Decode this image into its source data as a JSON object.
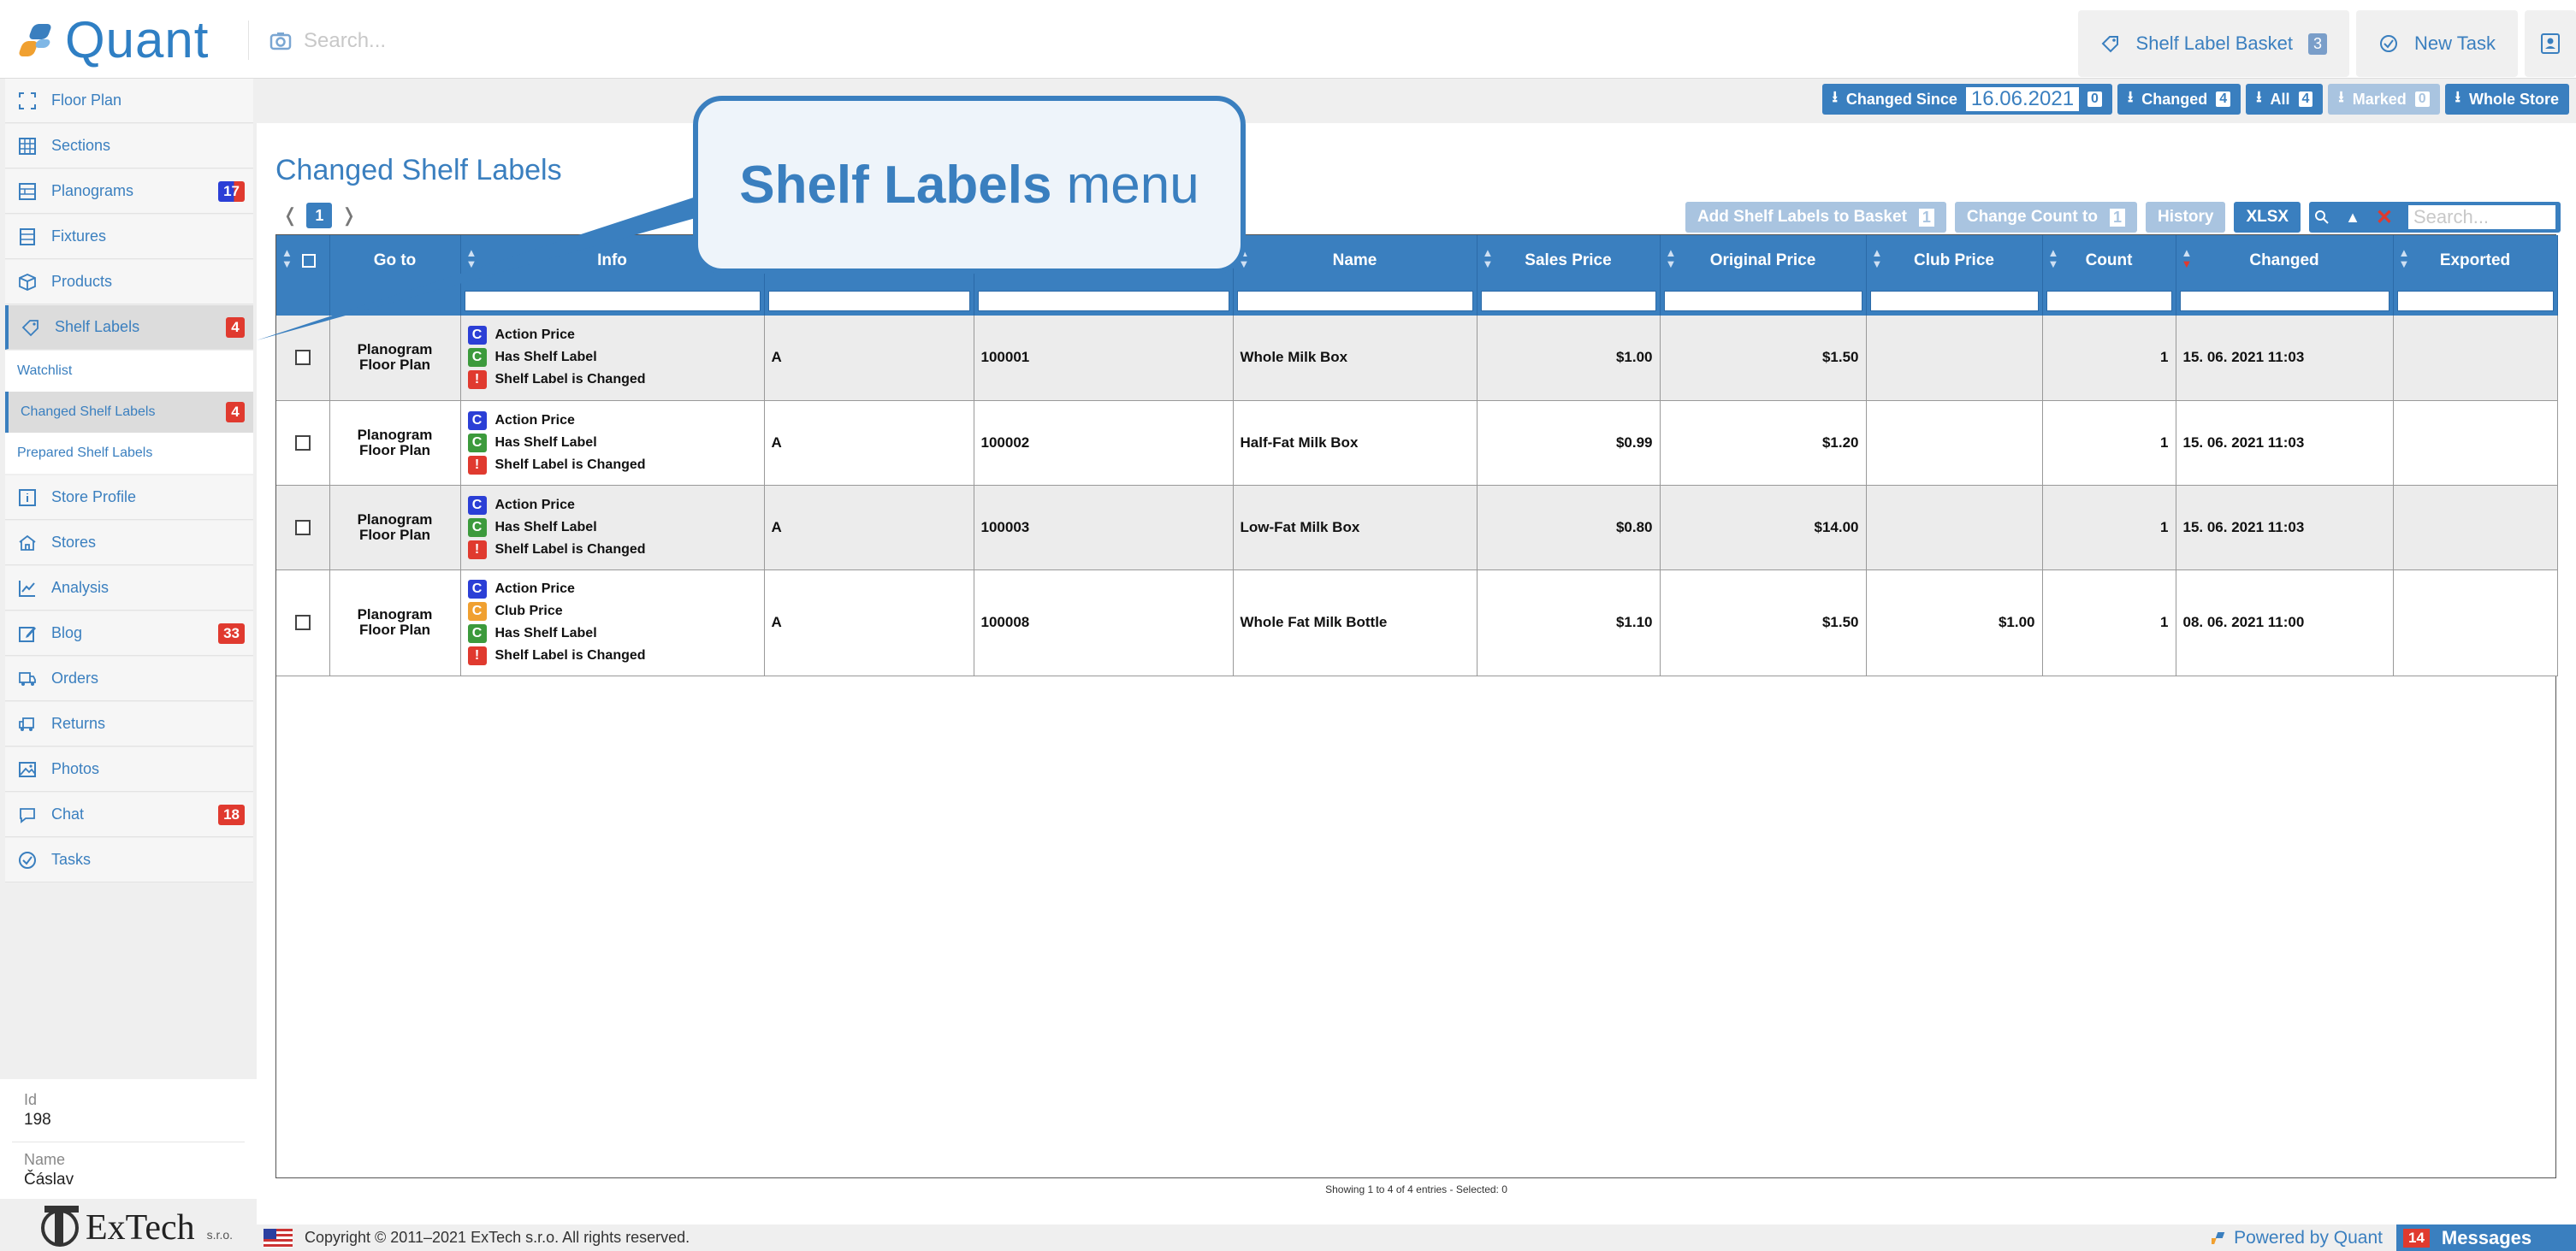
{
  "app": {
    "name": "Quant"
  },
  "topbar": {
    "search_placeholder": "Search...",
    "basket_label": "Shelf Label Basket",
    "basket_count": "3",
    "new_task_label": "New Task"
  },
  "sidebar": {
    "items": [
      {
        "label": "Floor Plan",
        "icon": "floor-plan-icon"
      },
      {
        "label": "Sections",
        "icon": "grid-icon"
      },
      {
        "label": "Planograms",
        "icon": "planogram-icon",
        "badge": "17"
      },
      {
        "label": "Fixtures",
        "icon": "fixture-icon"
      },
      {
        "label": "Products",
        "icon": "box-icon"
      },
      {
        "label": "Shelf Labels",
        "icon": "tag-icon",
        "badge": "4"
      },
      {
        "label": "Store Profile",
        "icon": "info-icon"
      },
      {
        "label": "Stores",
        "icon": "store-icon"
      },
      {
        "label": "Analysis",
        "icon": "chart-icon"
      },
      {
        "label": "Blog",
        "icon": "blog-icon",
        "badge": "33"
      },
      {
        "label": "Orders",
        "icon": "truck-icon"
      },
      {
        "label": "Returns",
        "icon": "return-icon"
      },
      {
        "label": "Photos",
        "icon": "photo-icon"
      },
      {
        "label": "Chat",
        "icon": "chat-icon",
        "badge": "18"
      },
      {
        "label": "Tasks",
        "icon": "check-circle-icon"
      }
    ],
    "sub_items": [
      {
        "label": "Watchlist"
      },
      {
        "label": "Changed Shelf Labels",
        "badge": "4"
      },
      {
        "label": "Prepared Shelf Labels"
      }
    ],
    "store": {
      "id_label": "Id",
      "id_value": "198",
      "name_label": "Name",
      "name_value": "Čáslav"
    },
    "company": {
      "name": "ExTech",
      "suffix": "s.r.o."
    }
  },
  "actions": {
    "changed_since_label": "Changed Since",
    "changed_since_date": "16.06.2021",
    "changed_since_count": "0",
    "changed_label": "Changed",
    "changed_count": "4",
    "all_label": "All",
    "all_count": "4",
    "marked_label": "Marked",
    "marked_count": "0",
    "whole_store_label": "Whole Store"
  },
  "page": {
    "title": "Changed Shelf Labels",
    "current_page": "1",
    "prev": "❬",
    "next": "❭"
  },
  "tools": {
    "add_basket_label": "Add Shelf Labels to Basket",
    "add_basket_count": "1",
    "change_count_label": "Change Count to",
    "change_count_value": "1",
    "history_label": "History",
    "xlsx_label": "XLSX",
    "search_placeholder": "Search..."
  },
  "table": {
    "columns": [
      "Go to",
      "Info",
      "",
      "",
      "Name",
      "Sales Price",
      "Original Price",
      "Club Price",
      "Count",
      "Changed",
      "Exported"
    ],
    "goto_line1": "Planogram",
    "goto_line2": "Floor Plan",
    "rows": [
      {
        "flags": [
          [
            "C",
            "Action Price",
            "#2b3fd6"
          ],
          [
            "C",
            "Has Shelf Label",
            "#3c9a3c"
          ],
          [
            "!",
            "Shelf Label is Changed",
            "#e03a2f"
          ]
        ],
        "col3": "A",
        "code": "100001",
        "name": "Whole Milk Box",
        "sales": "$1.00",
        "original": "$1.50",
        "club": "",
        "count": "1",
        "changed": "15. 06. 2021 11:03",
        "exported": ""
      },
      {
        "flags": [
          [
            "C",
            "Action Price",
            "#2b3fd6"
          ],
          [
            "C",
            "Has Shelf Label",
            "#3c9a3c"
          ],
          [
            "!",
            "Shelf Label is Changed",
            "#e03a2f"
          ]
        ],
        "col3": "A",
        "code": "100002",
        "name": "Half-Fat Milk Box",
        "sales": "$0.99",
        "original": "$1.20",
        "club": "",
        "count": "1",
        "changed": "15. 06. 2021 11:03",
        "exported": ""
      },
      {
        "flags": [
          [
            "C",
            "Action Price",
            "#2b3fd6"
          ],
          [
            "C",
            "Has Shelf Label",
            "#3c9a3c"
          ],
          [
            "!",
            "Shelf Label is Changed",
            "#e03a2f"
          ]
        ],
        "col3": "A",
        "code": "100003",
        "name": "Low-Fat Milk Box",
        "sales": "$0.80",
        "original": "$14.00",
        "club": "",
        "count": "1",
        "changed": "15. 06. 2021 11:03",
        "exported": ""
      },
      {
        "flags": [
          [
            "C",
            "Action Price",
            "#2b3fd6"
          ],
          [
            "C",
            "Club Price",
            "#f0a030"
          ],
          [
            "C",
            "Has Shelf Label",
            "#3c9a3c"
          ],
          [
            "!",
            "Shelf Label is Changed",
            "#e03a2f"
          ]
        ],
        "col3": "A",
        "code": "100008",
        "name": "Whole Fat Milk Bottle",
        "sales": "$1.10",
        "original": "$1.50",
        "club": "$1.00",
        "count": "1",
        "changed": "08. 06. 2021 11:00",
        "exported": ""
      }
    ],
    "showing": "Showing 1 to 4 of 4 entries - Selected: 0"
  },
  "callout": {
    "bold": "Shelf Labels",
    "rest": " menu"
  },
  "footer": {
    "copyright": "Copyright © 2011–2021 ExTech s.r.o. All rights reserved.",
    "powered": "Powered by Quant",
    "messages_count": "14",
    "messages_label": "Messages"
  },
  "colors": {
    "accent": "#3a7fbf",
    "badge_red": "#e03a2f",
    "badge_blue": "#2b3fd6",
    "green": "#3c9a3c",
    "orange": "#f0a030"
  }
}
